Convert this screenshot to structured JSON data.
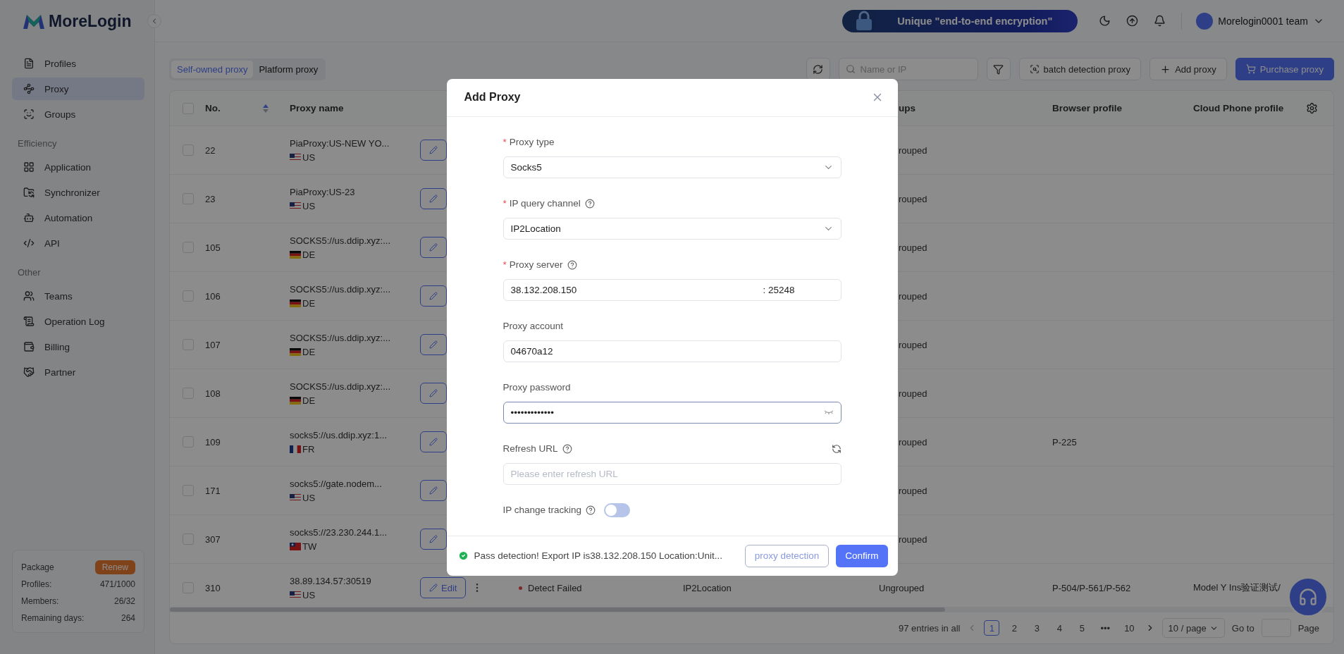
{
  "logo": "MoreLogin",
  "sidebar": {
    "sections": [
      {
        "items": [
          {
            "label": "Profiles",
            "selected": false
          },
          {
            "label": "Proxy",
            "selected": true
          },
          {
            "label": "Groups",
            "selected": false
          }
        ]
      },
      {
        "heading": "Efficiency",
        "items": [
          {
            "label": "Application",
            "selected": false
          },
          {
            "label": "Synchronizer",
            "selected": false
          },
          {
            "label": "Automation",
            "selected": false
          },
          {
            "label": "API",
            "selected": false
          }
        ]
      },
      {
        "heading": "Other",
        "items": [
          {
            "label": "Teams",
            "selected": false
          },
          {
            "label": "Operation Log",
            "selected": false
          },
          {
            "label": "Billing",
            "selected": false
          },
          {
            "label": "Partner",
            "selected": false
          }
        ]
      }
    ]
  },
  "package": {
    "title": "Package",
    "renew": "Renew",
    "rows": [
      {
        "label": "Profiles:",
        "value": "471/1000"
      },
      {
        "label": "Members:",
        "value": "26/32"
      },
      {
        "label": "Remaining days:",
        "value": "264"
      }
    ]
  },
  "header": {
    "banner": "Unique \"end-to-end encryption\"",
    "account": "Morelogin0001 team"
  },
  "tabs": [
    {
      "label": "Self-owned proxy",
      "selected": true
    },
    {
      "label": "Platform proxy",
      "selected": false
    }
  ],
  "toolbar": {
    "search_placeholder": "Name or IP",
    "batch": "batch detection proxy",
    "add": "Add proxy",
    "purchase": "Purchase proxy"
  },
  "table": {
    "select_all_checked": false,
    "columns": [
      "No.",
      "Proxy name",
      "ups",
      "Browser profile",
      "Cloud Phone profile"
    ],
    "rows": [
      {
        "checked": false,
        "no": "22",
        "name": "PiaProxy:US-NEW YO...",
        "country": "US",
        "flag": {
          "kind": "us"
        },
        "groups": "rouped"
      },
      {
        "checked": false,
        "no": "23",
        "name": "PiaProxy:US-23",
        "country": "US",
        "flag": {
          "kind": "us"
        },
        "groups": "rouped"
      },
      {
        "checked": false,
        "no": "105",
        "name": "SOCKS5://us.ddip.xyz:...",
        "country": "DE",
        "flag": {
          "kind": "de"
        },
        "groups": "rouped"
      },
      {
        "checked": false,
        "no": "106",
        "name": "SOCKS5://us.ddip.xyz:...",
        "country": "DE",
        "flag": {
          "kind": "de"
        },
        "groups": "rouped"
      },
      {
        "checked": false,
        "no": "107",
        "name": "SOCKS5://us.ddip.xyz:...",
        "country": "DE",
        "flag": {
          "kind": "de"
        },
        "groups": "rouped"
      },
      {
        "checked": false,
        "no": "108",
        "name": "SOCKS5://us.ddip.xyz:...",
        "country": "DE",
        "flag": {
          "kind": "de"
        },
        "groups": "rouped"
      },
      {
        "checked": false,
        "no": "109",
        "name": "socks5://us.ddip.xyz:1...",
        "country": "FR",
        "flag": {
          "kind": "fr"
        },
        "groups": "rouped",
        "browser": "P-225"
      },
      {
        "checked": false,
        "no": "171",
        "name": "socks5://gate.nodem...",
        "country": "US",
        "flag": {
          "kind": "us"
        },
        "groups": "rouped"
      },
      {
        "checked": false,
        "no": "307",
        "name": "socks5://23.230.244.1...",
        "country": "TW",
        "flag": {
          "kind": "tw"
        },
        "groups": "rouped"
      },
      {
        "checked": false,
        "no": "310",
        "name": "38.89.134.57:30519",
        "country": "US",
        "flag": {
          "kind": "us"
        },
        "edit": "Edit",
        "status": "Detect Failed",
        "channel": "IP2Location",
        "groups": "Ungrouped",
        "browser": "P-504/P-561/P-562",
        "cloud": "Model Y Ins验证测试/"
      }
    ]
  },
  "pagination": {
    "total": "97 entries in all",
    "pages": [
      {
        "label": "1",
        "selected": true
      },
      {
        "label": "2",
        "selected": false
      },
      {
        "label": "3",
        "selected": false
      },
      {
        "label": "4",
        "selected": false
      },
      {
        "label": "5",
        "selected": false
      },
      {
        "label": "•••",
        "selected": false
      },
      {
        "label": "10",
        "selected": false
      }
    ],
    "page_size": "10 / page",
    "goto": "Go to",
    "suffix": "Page"
  },
  "modal": {
    "title": "Add Proxy",
    "fields": [
      {
        "kind": "select",
        "mark": "*",
        "label": "Proxy type",
        "help": false,
        "value": "Socks5"
      },
      {
        "kind": "select",
        "mark": "*",
        "label": "IP query channel",
        "help": true,
        "value": "IP2Location"
      },
      {
        "kind": "server",
        "mark": "*",
        "label": "Proxy server",
        "help": true,
        "value": "38.132.208.150",
        "port": ": 25248"
      },
      {
        "kind": "text",
        "label": "Proxy account",
        "help": false,
        "value": "04670a12"
      },
      {
        "kind": "password",
        "label": "Proxy password",
        "help": false,
        "value": "•••••••••••••",
        "focused": true
      },
      {
        "kind": "url",
        "label": "Refresh URL",
        "help": true,
        "placeholder": "Please enter refresh URL"
      },
      {
        "kind": "toggle",
        "label": "IP change tracking",
        "help": true,
        "on": false
      }
    ],
    "status": "Pass detection! Export IP is38.132.208.150 Location:Unit...",
    "detect": "proxy detection",
    "confirm": "Confirm"
  }
}
